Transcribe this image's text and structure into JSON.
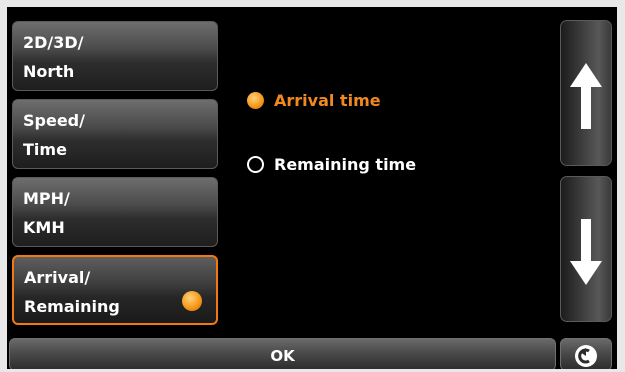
{
  "menu": {
    "items": [
      {
        "line1": "2D/3D/",
        "line2": "North"
      },
      {
        "line1": "Speed/",
        "line2": "Time"
      },
      {
        "line1": "MPH/",
        "line2": "KMH"
      },
      {
        "line1": "Arrival/",
        "line2": "Remaining"
      }
    ],
    "selected_index": 3
  },
  "options": {
    "arrival_time": "Arrival time",
    "remaining_time": "Remaining time",
    "selected": "arrival_time"
  },
  "footer": {
    "ok_label": "OK"
  },
  "icons": {
    "scroll_up": "up-arrow-icon",
    "scroll_down": "down-arrow-icon",
    "back": "back-icon",
    "selected_dot": "orange-dot-icon"
  },
  "colors": {
    "accent": "#f07a12",
    "background": "#000000"
  }
}
